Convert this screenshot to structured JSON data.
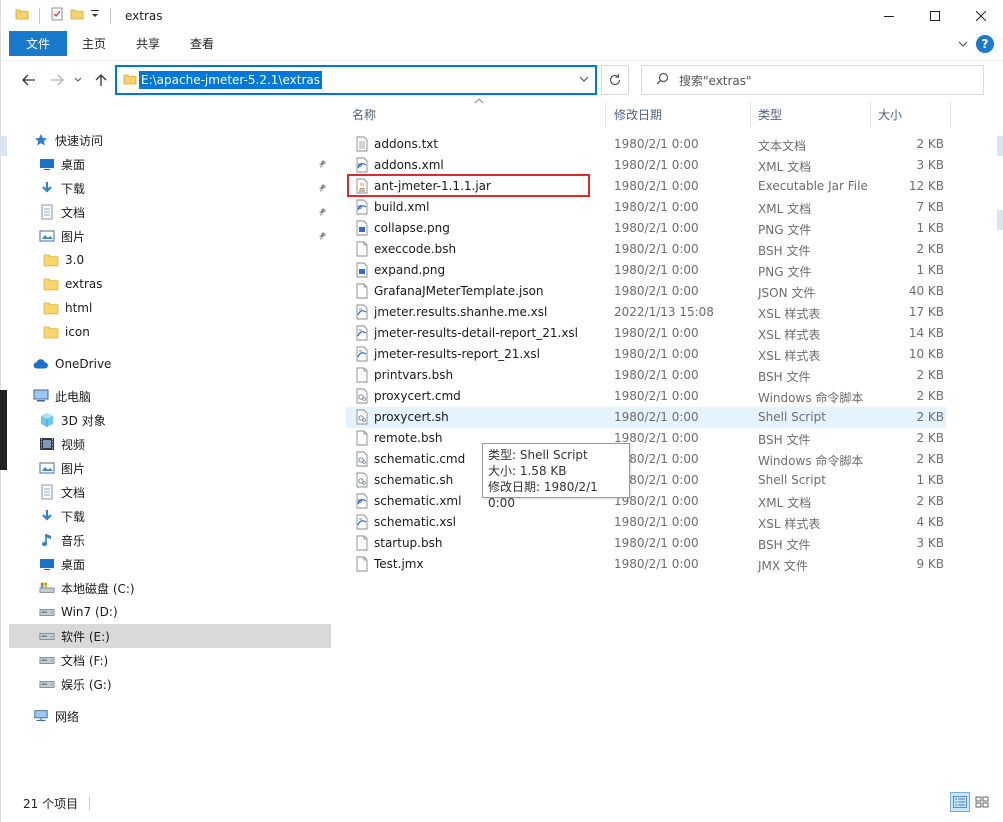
{
  "window": {
    "title": "extras"
  },
  "ribbon": {
    "tabs": [
      "文件",
      "主页",
      "共享",
      "查看"
    ]
  },
  "address": {
    "path": "E:\\apache-jmeter-5.2.1\\extras",
    "search_placeholder": "搜索\"extras\""
  },
  "nav": {
    "items": [
      {
        "label": "快速访问",
        "icon": "star-icon",
        "pinned": false
      },
      {
        "label": "桌面",
        "icon": "desktop-icon",
        "pinned": true
      },
      {
        "label": "下载",
        "icon": "download-icon",
        "pinned": true
      },
      {
        "label": "文档",
        "icon": "document-icon",
        "pinned": true
      },
      {
        "label": "图片",
        "icon": "picture-icon",
        "pinned": true
      },
      {
        "label": "3.0",
        "icon": "folder-icon",
        "pinned": false
      },
      {
        "label": "extras",
        "icon": "folder-icon",
        "pinned": false
      },
      {
        "label": "html",
        "icon": "folder-icon",
        "pinned": false
      },
      {
        "label": "icon",
        "icon": "folder-icon",
        "pinned": false
      },
      {
        "label": "OneDrive",
        "icon": "cloud-icon",
        "pinned": false
      },
      {
        "label": "此电脑",
        "icon": "computer-icon",
        "pinned": false
      },
      {
        "label": "3D 对象",
        "icon": "cube-icon",
        "pinned": false
      },
      {
        "label": "视频",
        "icon": "video-icon",
        "pinned": false
      },
      {
        "label": "图片",
        "icon": "picture-icon",
        "pinned": false
      },
      {
        "label": "文档",
        "icon": "document-icon",
        "pinned": false
      },
      {
        "label": "下载",
        "icon": "download-icon",
        "pinned": false
      },
      {
        "label": "音乐",
        "icon": "music-icon",
        "pinned": false
      },
      {
        "label": "桌面",
        "icon": "desktop-icon",
        "pinned": false
      },
      {
        "label": "本地磁盘 (C:)",
        "icon": "system-drive-icon",
        "pinned": false
      },
      {
        "label": "Win7 (D:)",
        "icon": "drive-icon",
        "pinned": false
      },
      {
        "label": "软件 (E:)",
        "icon": "drive-icon",
        "pinned": false,
        "selected": true
      },
      {
        "label": "文档 (F:)",
        "icon": "drive-icon",
        "pinned": false
      },
      {
        "label": "娱乐 (G:)",
        "icon": "drive-icon",
        "pinned": false
      },
      {
        "label": "网络",
        "icon": "network-icon",
        "pinned": false
      }
    ]
  },
  "columns": {
    "name": "名称",
    "date": "修改日期",
    "type": "类型",
    "size": "大小"
  },
  "files": [
    {
      "name": "addons.txt",
      "date": "1980/2/1 0:00",
      "type": "文本文档",
      "size": "2 KB",
      "icon": "text-file-icon"
    },
    {
      "name": "addons.xml",
      "date": "1980/2/1 0:00",
      "type": "XML 文档",
      "size": "3 KB",
      "icon": "xml-file-icon"
    },
    {
      "name": "ant-jmeter-1.1.1.jar",
      "date": "1980/2/1 0:00",
      "type": "Executable Jar File",
      "size": "12 KB",
      "icon": "jar-file-icon"
    },
    {
      "name": "build.xml",
      "date": "1980/2/1 0:00",
      "type": "XML 文档",
      "size": "7 KB",
      "icon": "xml-file-icon"
    },
    {
      "name": "collapse.png",
      "date": "1980/2/1 0:00",
      "type": "PNG 文件",
      "size": "1 KB",
      "icon": "image-file-icon"
    },
    {
      "name": "execcode.bsh",
      "date": "1980/2/1 0:00",
      "type": "BSH 文件",
      "size": "2 KB",
      "icon": "blank-file-icon"
    },
    {
      "name": "expand.png",
      "date": "1980/2/1 0:00",
      "type": "PNG 文件",
      "size": "1 KB",
      "icon": "image-file-icon"
    },
    {
      "name": "GrafanaJMeterTemplate.json",
      "date": "1980/2/1 0:00",
      "type": "JSON 文件",
      "size": "40 KB",
      "icon": "blank-file-icon"
    },
    {
      "name": "jmeter.results.shanhe.me.xsl",
      "date": "2022/1/13 15:08",
      "type": "XSL 样式表",
      "size": "17 KB",
      "icon": "xsl-file-icon"
    },
    {
      "name": "jmeter-results-detail-report_21.xsl",
      "date": "1980/2/1 0:00",
      "type": "XSL 样式表",
      "size": "14 KB",
      "icon": "xsl-file-icon"
    },
    {
      "name": "jmeter-results-report_21.xsl",
      "date": "1980/2/1 0:00",
      "type": "XSL 样式表",
      "size": "10 KB",
      "icon": "xsl-file-icon"
    },
    {
      "name": "printvars.bsh",
      "date": "1980/2/1 0:00",
      "type": "BSH 文件",
      "size": "2 KB",
      "icon": "blank-file-icon"
    },
    {
      "name": "proxycert.cmd",
      "date": "1980/2/1 0:00",
      "type": "Windows 命令脚本",
      "size": "2 KB",
      "icon": "script-file-icon"
    },
    {
      "name": "proxycert.sh",
      "date": "1980/2/1 0:00",
      "type": "Shell Script",
      "size": "2 KB",
      "icon": "script-file-icon",
      "hover": true
    },
    {
      "name": "remote.bsh",
      "date": "1980/2/1 0:00",
      "type": "BSH 文件",
      "size": "2 KB",
      "icon": "blank-file-icon"
    },
    {
      "name": "schematic.cmd",
      "date": "1980/2/1 0:00",
      "type": "Windows 命令脚本",
      "size": "2 KB",
      "icon": "script-file-icon"
    },
    {
      "name": "schematic.sh",
      "date": "1980/2/1 0:00",
      "type": "Shell Script",
      "size": "1 KB",
      "icon": "script-file-icon"
    },
    {
      "name": "schematic.xml",
      "date": "1980/2/1 0:00",
      "type": "XML 文档",
      "size": "2 KB",
      "icon": "xml-file-icon"
    },
    {
      "name": "schematic.xsl",
      "date": "1980/2/1 0:00",
      "type": "XSL 样式表",
      "size": "4 KB",
      "icon": "xsl-file-icon"
    },
    {
      "name": "startup.bsh",
      "date": "1980/2/1 0:00",
      "type": "BSH 文件",
      "size": "3 KB",
      "icon": "blank-file-icon"
    },
    {
      "name": "Test.jmx",
      "date": "1980/2/1 0:00",
      "type": "JMX 文件",
      "size": "9 KB",
      "icon": "blank-file-icon"
    }
  ],
  "tooltip": {
    "type_line": "类型: Shell Script",
    "size_line": "大小: 1.58 KB",
    "date_line": "修改日期: 1980/2/1 0:00"
  },
  "status": {
    "count": "21 个项目"
  },
  "colors": {
    "accent": "#0078d7",
    "file_tab": "#1979ca",
    "highlight_box": "#e02a2a",
    "hover_row": "#e5f3ff"
  }
}
